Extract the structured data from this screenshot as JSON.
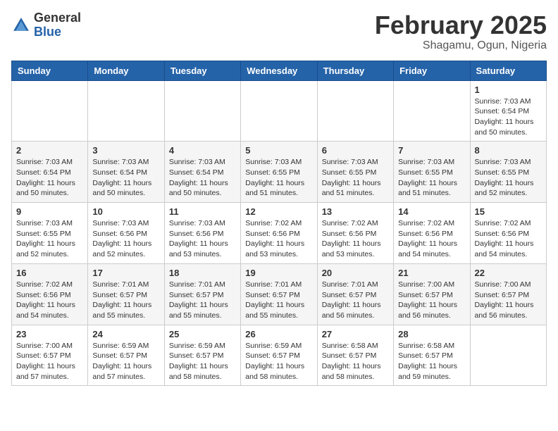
{
  "header": {
    "logo": {
      "general": "General",
      "blue": "Blue"
    },
    "month_year": "February 2025",
    "location": "Shagamu, Ogun, Nigeria"
  },
  "weekdays": [
    "Sunday",
    "Monday",
    "Tuesday",
    "Wednesday",
    "Thursday",
    "Friday",
    "Saturday"
  ],
  "weeks": [
    [
      {
        "day": "",
        "info": ""
      },
      {
        "day": "",
        "info": ""
      },
      {
        "day": "",
        "info": ""
      },
      {
        "day": "",
        "info": ""
      },
      {
        "day": "",
        "info": ""
      },
      {
        "day": "",
        "info": ""
      },
      {
        "day": "1",
        "info": "Sunrise: 7:03 AM\nSunset: 6:54 PM\nDaylight: 11 hours\nand 50 minutes."
      }
    ],
    [
      {
        "day": "2",
        "info": "Sunrise: 7:03 AM\nSunset: 6:54 PM\nDaylight: 11 hours\nand 50 minutes."
      },
      {
        "day": "3",
        "info": "Sunrise: 7:03 AM\nSunset: 6:54 PM\nDaylight: 11 hours\nand 50 minutes."
      },
      {
        "day": "4",
        "info": "Sunrise: 7:03 AM\nSunset: 6:54 PM\nDaylight: 11 hours\nand 50 minutes."
      },
      {
        "day": "5",
        "info": "Sunrise: 7:03 AM\nSunset: 6:55 PM\nDaylight: 11 hours\nand 51 minutes."
      },
      {
        "day": "6",
        "info": "Sunrise: 7:03 AM\nSunset: 6:55 PM\nDaylight: 11 hours\nand 51 minutes."
      },
      {
        "day": "7",
        "info": "Sunrise: 7:03 AM\nSunset: 6:55 PM\nDaylight: 11 hours\nand 51 minutes."
      },
      {
        "day": "8",
        "info": "Sunrise: 7:03 AM\nSunset: 6:55 PM\nDaylight: 11 hours\nand 52 minutes."
      }
    ],
    [
      {
        "day": "9",
        "info": "Sunrise: 7:03 AM\nSunset: 6:55 PM\nDaylight: 11 hours\nand 52 minutes."
      },
      {
        "day": "10",
        "info": "Sunrise: 7:03 AM\nSunset: 6:56 PM\nDaylight: 11 hours\nand 52 minutes."
      },
      {
        "day": "11",
        "info": "Sunrise: 7:03 AM\nSunset: 6:56 PM\nDaylight: 11 hours\nand 53 minutes."
      },
      {
        "day": "12",
        "info": "Sunrise: 7:02 AM\nSunset: 6:56 PM\nDaylight: 11 hours\nand 53 minutes."
      },
      {
        "day": "13",
        "info": "Sunrise: 7:02 AM\nSunset: 6:56 PM\nDaylight: 11 hours\nand 53 minutes."
      },
      {
        "day": "14",
        "info": "Sunrise: 7:02 AM\nSunset: 6:56 PM\nDaylight: 11 hours\nand 54 minutes."
      },
      {
        "day": "15",
        "info": "Sunrise: 7:02 AM\nSunset: 6:56 PM\nDaylight: 11 hours\nand 54 minutes."
      }
    ],
    [
      {
        "day": "16",
        "info": "Sunrise: 7:02 AM\nSunset: 6:56 PM\nDaylight: 11 hours\nand 54 minutes."
      },
      {
        "day": "17",
        "info": "Sunrise: 7:01 AM\nSunset: 6:57 PM\nDaylight: 11 hours\nand 55 minutes."
      },
      {
        "day": "18",
        "info": "Sunrise: 7:01 AM\nSunset: 6:57 PM\nDaylight: 11 hours\nand 55 minutes."
      },
      {
        "day": "19",
        "info": "Sunrise: 7:01 AM\nSunset: 6:57 PM\nDaylight: 11 hours\nand 55 minutes."
      },
      {
        "day": "20",
        "info": "Sunrise: 7:01 AM\nSunset: 6:57 PM\nDaylight: 11 hours\nand 56 minutes."
      },
      {
        "day": "21",
        "info": "Sunrise: 7:00 AM\nSunset: 6:57 PM\nDaylight: 11 hours\nand 56 minutes."
      },
      {
        "day": "22",
        "info": "Sunrise: 7:00 AM\nSunset: 6:57 PM\nDaylight: 11 hours\nand 56 minutes."
      }
    ],
    [
      {
        "day": "23",
        "info": "Sunrise: 7:00 AM\nSunset: 6:57 PM\nDaylight: 11 hours\nand 57 minutes."
      },
      {
        "day": "24",
        "info": "Sunrise: 6:59 AM\nSunset: 6:57 PM\nDaylight: 11 hours\nand 57 minutes."
      },
      {
        "day": "25",
        "info": "Sunrise: 6:59 AM\nSunset: 6:57 PM\nDaylight: 11 hours\nand 58 minutes."
      },
      {
        "day": "26",
        "info": "Sunrise: 6:59 AM\nSunset: 6:57 PM\nDaylight: 11 hours\nand 58 minutes."
      },
      {
        "day": "27",
        "info": "Sunrise: 6:58 AM\nSunset: 6:57 PM\nDaylight: 11 hours\nand 58 minutes."
      },
      {
        "day": "28",
        "info": "Sunrise: 6:58 AM\nSunset: 6:57 PM\nDaylight: 11 hours\nand 59 minutes."
      },
      {
        "day": "",
        "info": ""
      }
    ]
  ]
}
